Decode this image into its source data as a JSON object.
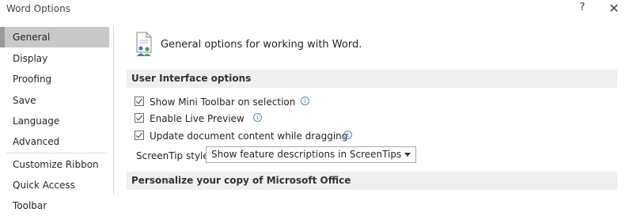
{
  "window": {
    "title": "Word Options",
    "help_glyph": "?",
    "close_glyph": "✕"
  },
  "sidebar": {
    "items": [
      {
        "label": "General",
        "active": true
      },
      {
        "label": "Display"
      },
      {
        "label": "Proofing"
      },
      {
        "label": "Save"
      },
      {
        "label": "Language"
      },
      {
        "label": "Advanced"
      },
      {
        "label": "Customize Ribbon"
      },
      {
        "label": "Quick Access Toolbar"
      }
    ]
  },
  "main": {
    "header_icon": "general-options-icon",
    "header_text": "General options for working with Word.",
    "sections": [
      {
        "title": "User Interface options"
      },
      {
        "title": "Personalize your copy of Microsoft Office"
      }
    ],
    "options": [
      {
        "label": "Show Mini Toolbar on selection",
        "checked": true
      },
      {
        "label": "Enable Live Preview",
        "checked": true
      },
      {
        "label": "Update document content while dragging",
        "checked": true
      }
    ],
    "info_glyph": "i",
    "screentip": {
      "label": "ScreenTip style:",
      "value": "Show feature descriptions in ScreenTips"
    }
  }
}
